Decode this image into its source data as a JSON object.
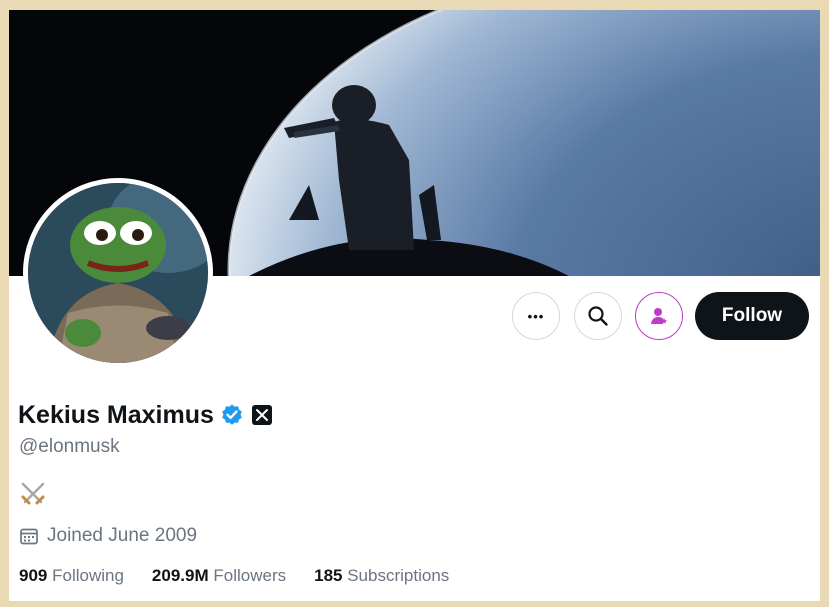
{
  "profile": {
    "display_name": "Kekius Maximus",
    "handle": "@elonmusk",
    "bio_emoji": "⚔",
    "joined": "Joined June 2009",
    "verified": true
  },
  "actions": {
    "more_label": "•••",
    "follow_label": "Follow"
  },
  "stats": {
    "following_count": "909",
    "following_label": "Following",
    "followers_count": "209.9M",
    "followers_label": "Followers",
    "subscriptions_count": "185",
    "subscriptions_label": "Subscriptions"
  },
  "colors": {
    "verified_blue": "#1d9bf0",
    "subscribe_magenta": "#c03bc8",
    "text_primary": "#0f1419",
    "text_secondary": "#6b7580"
  },
  "icons": {
    "more": "more-icon",
    "search": "search-icon",
    "subscribe": "subscribe-person-icon",
    "verified": "verified-badge-icon",
    "x_logo": "x-logo-icon",
    "calendar": "calendar-icon"
  }
}
